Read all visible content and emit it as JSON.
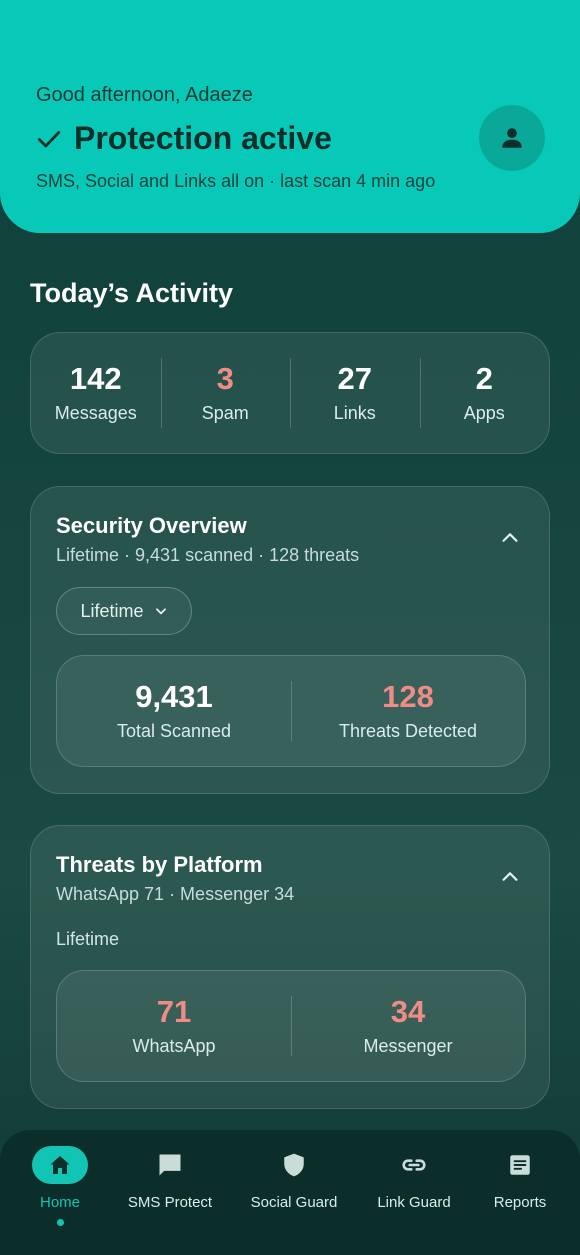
{
  "header": {
    "greeting": "Good afternoon, Adaeze",
    "status": "Protection active",
    "subtitle": "SMS, Social and Links all on · last scan 4 min ago"
  },
  "activity": {
    "title": "Today’s Activity",
    "stats": [
      {
        "value": "142",
        "label": "Messages"
      },
      {
        "value": "3",
        "label": "Spam"
      },
      {
        "value": "27",
        "label": "Links"
      },
      {
        "value": "2",
        "label": "Apps"
      }
    ]
  },
  "security_overview": {
    "title": "Security Overview",
    "subtitle": "Lifetime · 9,431 scanned · 128 threats",
    "filter": "Lifetime",
    "stats": [
      {
        "value": "9,431",
        "label": "Total Scanned"
      },
      {
        "value": "128",
        "label": "Threats Detected"
      }
    ]
  },
  "threats_by_platform": {
    "title": "Threats by Platform",
    "subtitle": "WhatsApp 71 · Messenger 34",
    "period": "Lifetime",
    "stats": [
      {
        "value": "71",
        "label": "WhatsApp"
      },
      {
        "value": "34",
        "label": "Messenger"
      }
    ]
  },
  "nav": {
    "items": [
      {
        "label": "Home",
        "icon": "home-icon",
        "active": true
      },
      {
        "label": "SMS Protect",
        "icon": "chat-icon"
      },
      {
        "label": "Social Guard",
        "icon": "shield-icon"
      },
      {
        "label": "Link Guard",
        "icon": "link-icon"
      },
      {
        "label": "Reports",
        "icon": "report-icon"
      }
    ]
  },
  "colors": {
    "accent": "#08c9b8",
    "alert": "#f08c86",
    "background": "#15453e"
  }
}
